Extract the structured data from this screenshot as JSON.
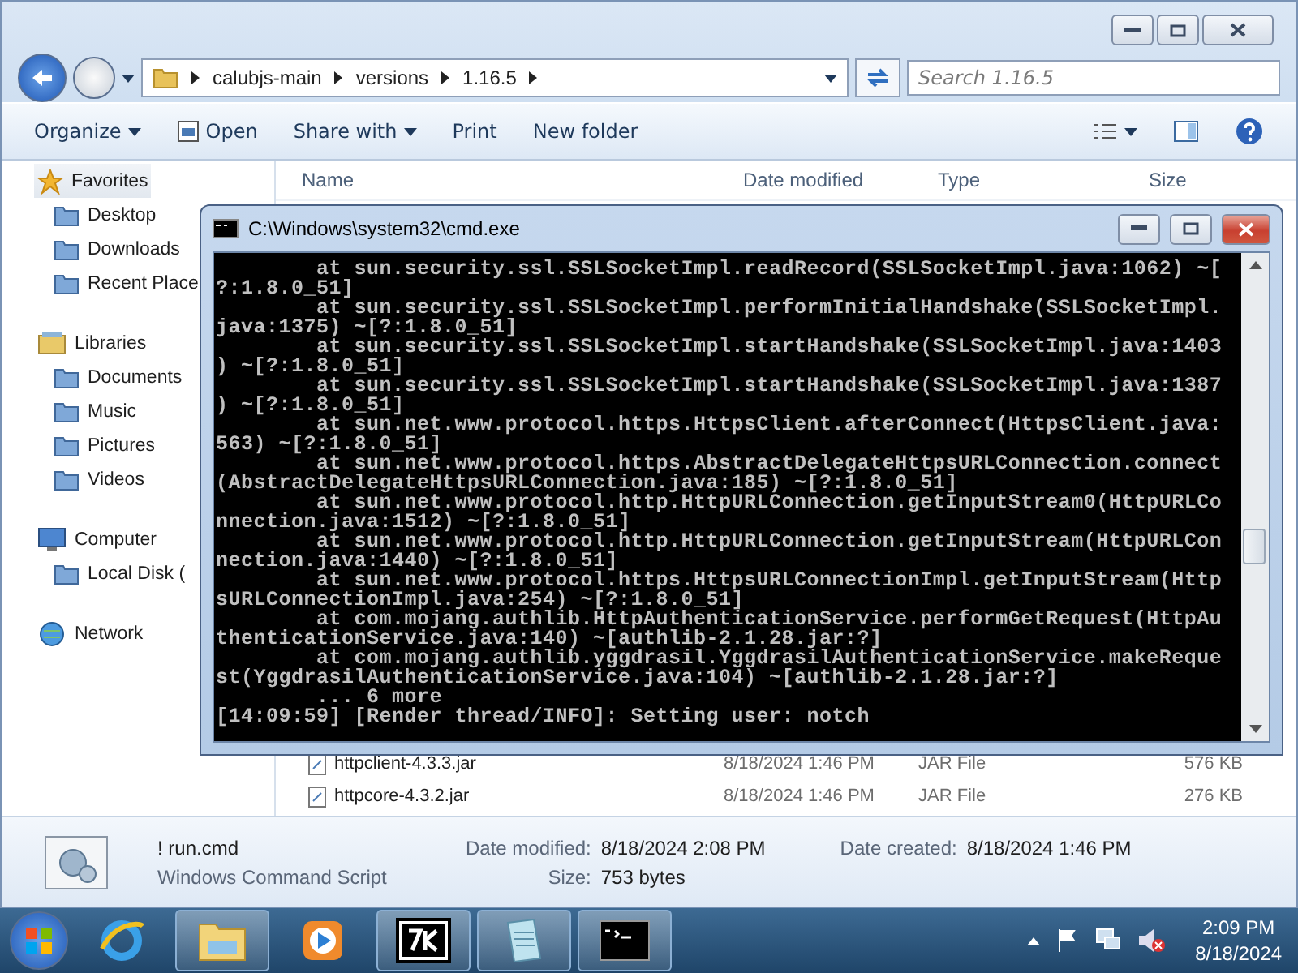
{
  "explorer": {
    "address": [
      "calubjs-main",
      "versions",
      "1.16.5"
    ],
    "search": {
      "placeholder": "Search 1.16.5"
    },
    "toolbar": [
      {
        "label": "Organize",
        "kind": "menu"
      },
      {
        "label": "Open",
        "kind": "action"
      },
      {
        "label": "Share with",
        "kind": "menu"
      },
      {
        "label": "Print",
        "kind": "plain"
      },
      {
        "label": "New folder",
        "kind": "plain"
      }
    ],
    "sidebar": [
      {
        "label": "Favorites",
        "selected": true,
        "children": [
          {
            "label": "Desktop"
          },
          {
            "label": "Downloads"
          },
          {
            "label": "Recent Place"
          }
        ]
      },
      {
        "label": "Libraries",
        "selected": false,
        "children": [
          {
            "label": "Documents"
          },
          {
            "label": "Music"
          },
          {
            "label": "Pictures"
          },
          {
            "label": "Videos"
          }
        ]
      },
      {
        "label": "Computer",
        "selected": false,
        "children": [
          {
            "label": "Local Disk ("
          }
        ]
      },
      {
        "label": "Network",
        "selected": false
      }
    ],
    "columns": [
      "Name",
      "Date modified",
      "Type",
      "Size"
    ],
    "rows": [
      {
        "name": "httpclient-4.3.3.jar",
        "date": "8/18/2024 1:46 PM",
        "type": "JAR File",
        "size": "576 KB"
      },
      {
        "name": "httpcore-4.3.2.jar",
        "date": "8/18/2024 1:46 PM",
        "type": "JAR File",
        "size": "276 KB"
      }
    ],
    "details": {
      "name": "! run.cmd",
      "type": "Windows Command Script",
      "fields": [
        {
          "label": "Date modified:",
          "value": "8/18/2024 2:08 PM"
        },
        {
          "label": "Date created:",
          "value": "8/18/2024 1:46 PM"
        },
        {
          "label": "Size:",
          "value": "753 bytes"
        }
      ]
    }
  },
  "console": {
    "title": "C:\\Windows\\system32\\cmd.exe",
    "lines": [
      "        at sun.security.ssl.SSLSocketImpl.readRecord(SSLSocketImpl.java:1062) ~[",
      "?:1.8.0_51]",
      "        at sun.security.ssl.SSLSocketImpl.performInitialHandshake(SSLSocketImpl.",
      "java:1375) ~[?:1.8.0_51]",
      "        at sun.security.ssl.SSLSocketImpl.startHandshake(SSLSocketImpl.java:1403",
      ") ~[?:1.8.0_51]",
      "        at sun.security.ssl.SSLSocketImpl.startHandshake(SSLSocketImpl.java:1387",
      ") ~[?:1.8.0_51]",
      "        at sun.net.www.protocol.https.HttpsClient.afterConnect(HttpsClient.java:",
      "563) ~[?:1.8.0_51]",
      "        at sun.net.www.protocol.https.AbstractDelegateHttpsURLConnection.connect",
      "(AbstractDelegateHttpsURLConnection.java:185) ~[?:1.8.0_51]",
      "        at sun.net.www.protocol.http.HttpURLConnection.getInputStream0(HttpURLCo",
      "nnection.java:1512) ~[?:1.8.0_51]",
      "        at sun.net.www.protocol.http.HttpURLConnection.getInputStream(HttpURLCon",
      "nection.java:1440) ~[?:1.8.0_51]",
      "        at sun.net.www.protocol.https.HttpsURLConnectionImpl.getInputStream(Http",
      "sURLConnectionImpl.java:254) ~[?:1.8.0_51]",
      "        at com.mojang.authlib.HttpAuthenticationService.performGetRequest(HttpAu",
      "thenticationService.java:140) ~[authlib-2.1.28.jar:?]",
      "        at com.mojang.authlib.yggdrasil.YggdrasilAuthenticationService.makeReque",
      "st(YggdrasilAuthenticationService.java:104) ~[authlib-2.1.28.jar:?]",
      "        ... 6 more",
      "[14:09:59] [Render thread/INFO]: Setting user: notch"
    ]
  },
  "taskbar": {
    "apps": [
      {
        "kind": "ie",
        "running": false
      },
      {
        "kind": "explorer",
        "running": true
      },
      {
        "kind": "media",
        "running": false
      },
      {
        "kind": "archiver",
        "running": true
      },
      {
        "kind": "notepad",
        "running": true
      },
      {
        "kind": "console",
        "running": true
      }
    ],
    "time": "2:09 PM",
    "date": "8/18/2024"
  }
}
